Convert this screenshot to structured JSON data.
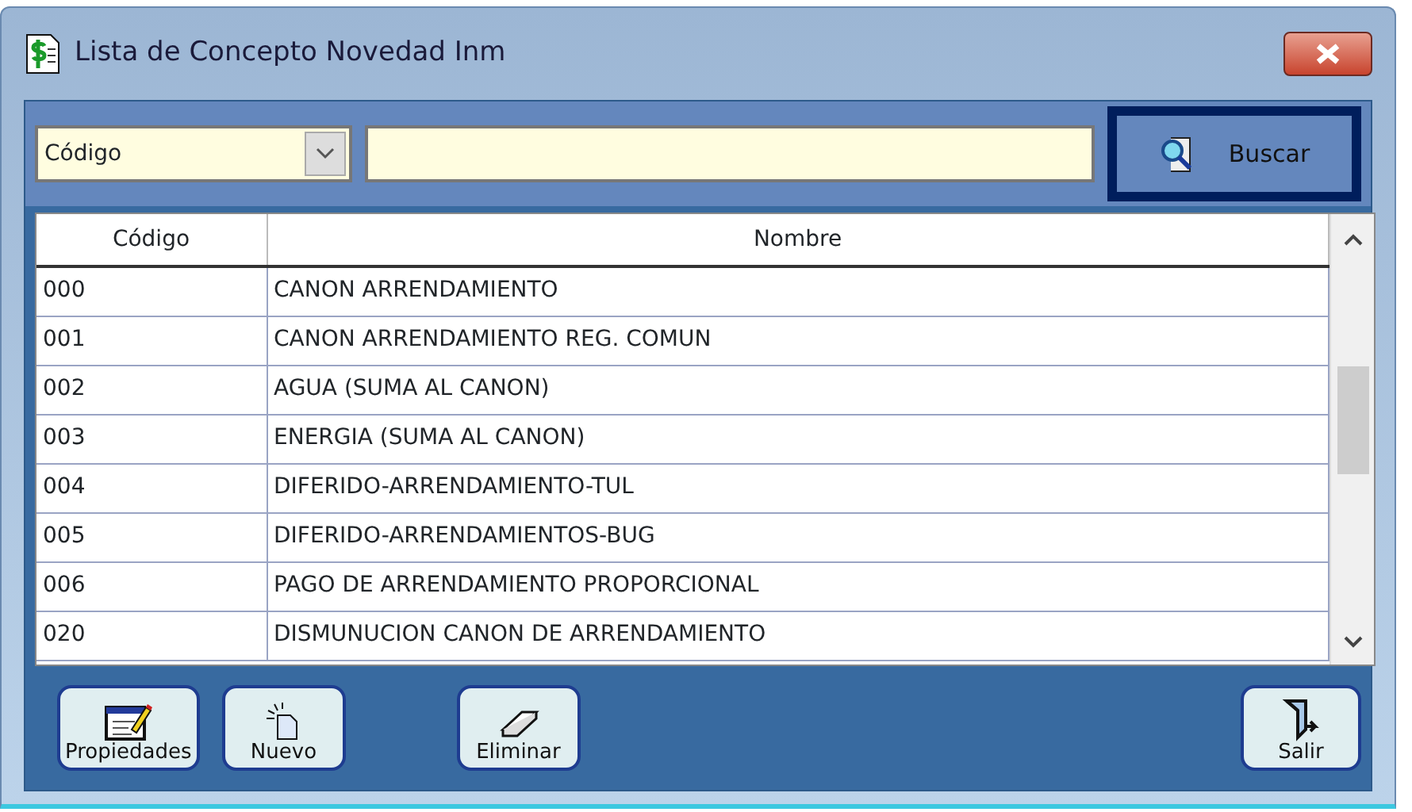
{
  "window": {
    "title": "Lista de Concepto Novedad Inm"
  },
  "search": {
    "field_select": "Código",
    "button": "Buscar"
  },
  "table": {
    "columns": [
      "Código",
      "Nombre"
    ],
    "rows": [
      {
        "codigo": "000",
        "nombre": "CANON ARRENDAMIENTO"
      },
      {
        "codigo": "001",
        "nombre": "CANON ARRENDAMIENTO REG. COMUN"
      },
      {
        "codigo": "002",
        "nombre": "AGUA (SUMA AL CANON)"
      },
      {
        "codigo": "003",
        "nombre": "ENERGIA (SUMA AL CANON)"
      },
      {
        "codigo": "004",
        "nombre": "DIFERIDO-ARRENDAMIENTO-TUL"
      },
      {
        "codigo": "005",
        "nombre": "DIFERIDO-ARRENDAMIENTOS-BUG"
      },
      {
        "codigo": "006",
        "nombre": "PAGO DE ARRENDAMIENTO PROPORCIONAL"
      },
      {
        "codigo": "020",
        "nombre": "DISMUNUCION CANON DE ARRENDAMIENTO"
      }
    ]
  },
  "buttons": [
    {
      "label": "Propiedades",
      "kind": "properties"
    },
    {
      "label": "Nuevo",
      "kind": "new"
    },
    {
      "label": "Eliminar",
      "kind": "delete"
    },
    {
      "label": "Salir",
      "kind": "exit"
    }
  ]
}
